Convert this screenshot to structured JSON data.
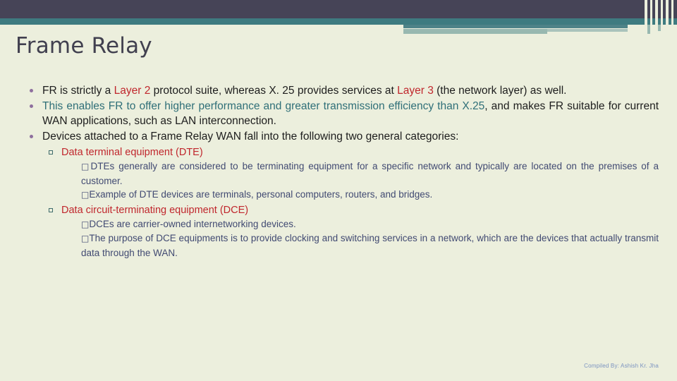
{
  "slide": {
    "title": "Frame Relay",
    "background_color": "#ecefdd",
    "header_dark_color": "#464457",
    "header_teal_color": "#3e7b80",
    "header_sage_color": "#98b8b0"
  },
  "colors": {
    "accent_red": "#c0272d",
    "accent_teal": "#2f6f78",
    "body_text": "#1d1d1d",
    "sub_text": "#414a72",
    "bullet_purple": "#8e6f9e",
    "bullet_square": "#3f6b6b",
    "footer_text": "#7b93c0"
  },
  "content": {
    "bullets": [
      {
        "id": "bullet-fr-layer2",
        "parts": [
          {
            "text": "FR  is  strictly  a  ",
            "style": "normal"
          },
          {
            "text": "Layer  2",
            "style": "red"
          },
          {
            "text": "  protocol  suite,  whereas  X. 25  provides services at ",
            "style": "normal"
          },
          {
            "text": "Layer 3",
            "style": "red"
          },
          {
            "text": " (the network layer) as well.",
            "style": "normal"
          }
        ]
      },
      {
        "id": "bullet-performance",
        "parts": [
          {
            "text": "This   enables   FR   to   offer   higher   performance   and   greater transmission efficiency than ",
            "style": "teal"
          },
          {
            "text": "X.25",
            "style": "teal"
          },
          {
            "text": ", and makes FR suitable for current  WAN applications, such as LAN interconnection.",
            "style": "normal"
          }
        ]
      },
      {
        "id": "bullet-devices",
        "parts": [
          {
            "text": "Devices   attached   to   a   Frame   Relay   WAN   fall   into   the   following two general categories:",
            "style": "normal"
          }
        ]
      }
    ],
    "categories": [
      {
        "id": "dte",
        "heading": "Data terminal equipment (DTE)",
        "details": [
          "DTEs generally are considered to be terminating equipment for a  specific network and typically are located on the premises of a  customer.",
          "Example  of  DTE  devices  are  terminals,  personal  computers,  routers, and bridges."
        ]
      },
      {
        "id": "dce",
        "heading": "Data circuit-terminating equipment (DCE)",
        "details": [
          "DCEs are carrier-owned internetworking devices.",
          "The  purpose  of  DCE  equipments  is  to  provide  clocking  and  switching  services  in  a  network,  which  are  the  devices  that  actually transmit data through the WAN."
        ]
      }
    ]
  },
  "footer": {
    "credit": "Compiled By: Ashish Kr. Jha"
  }
}
